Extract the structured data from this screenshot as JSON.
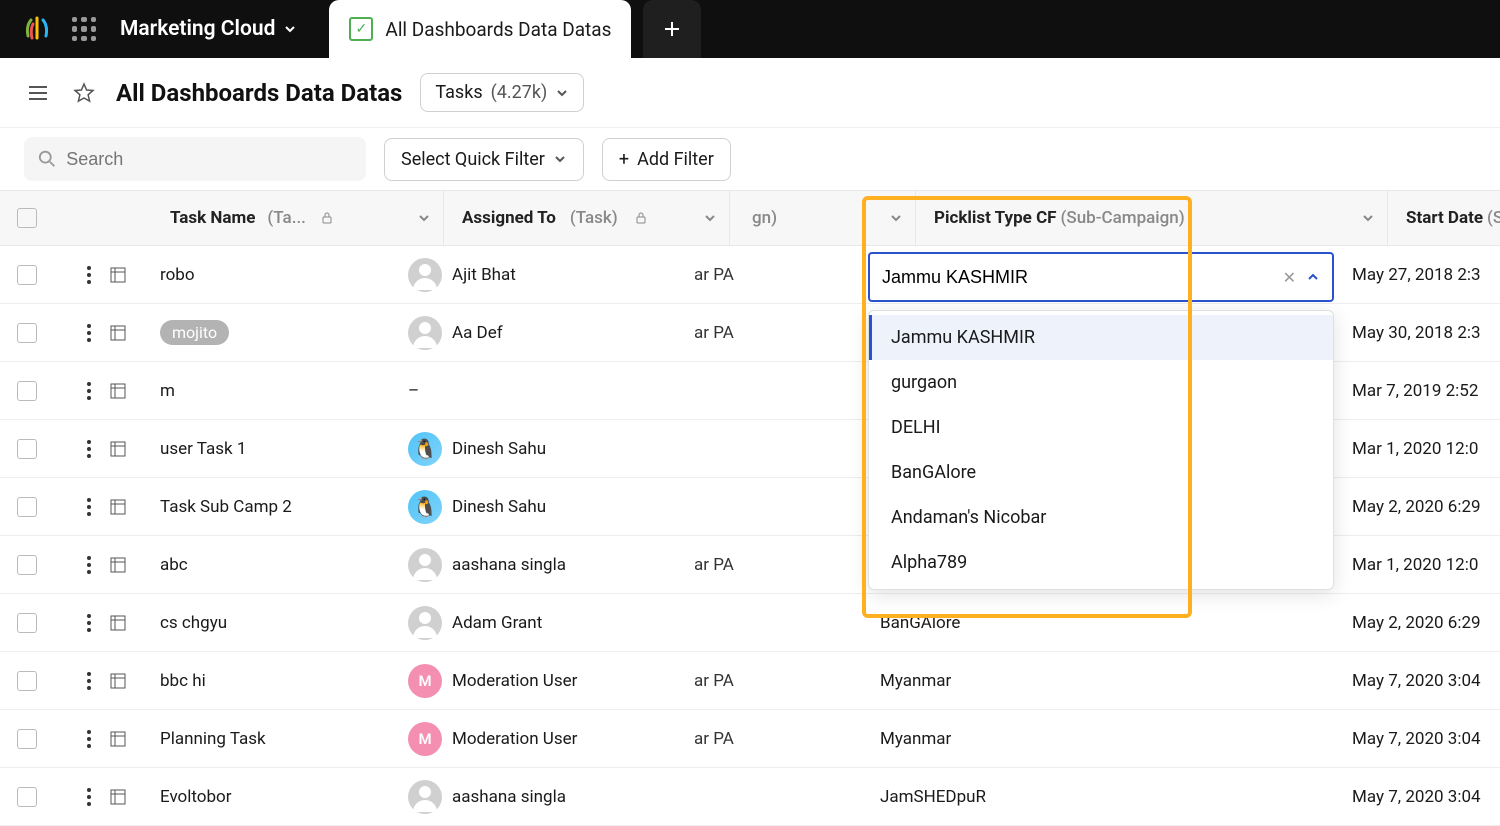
{
  "topbar": {
    "product_name": "Marketing Cloud",
    "active_tab": "All Dashboards Data Datas"
  },
  "header": {
    "title": "All Dashboards Data Datas",
    "tasks_label": "Tasks",
    "tasks_count": "(4.27k)"
  },
  "filters": {
    "search_placeholder": "Search",
    "quick_filter_label": "Select Quick Filter",
    "add_filter_label": "Add Filter"
  },
  "columns": {
    "taskname": {
      "label": "Task Name",
      "sub": "(Ta..."
    },
    "assigned": {
      "label": "Assigned To",
      "sub": "(Task)"
    },
    "midcut_suffix": "gn)",
    "picklist": {
      "label": "Picklist Type CF",
      "sub": "(Sub-Campaign)"
    },
    "start": {
      "label": "Start Date",
      "sub": "(Sub-"
    }
  },
  "picklist_editor": {
    "value": "Jammu KASHMIR",
    "options": [
      "Jammu KASHMIR",
      "gurgaon",
      "DELHI",
      "BanGAlore",
      "Andaman's Nicobar",
      "Alpha789"
    ]
  },
  "rows": [
    {
      "task": "robo",
      "chip": false,
      "assignee": "Ajit Bhat",
      "avatar": "gray",
      "initial": "",
      "midcut": "ar PA",
      "picklist": "",
      "start": "May 27, 2018 2:3"
    },
    {
      "task": "mojito",
      "chip": true,
      "assignee": "Aa Def",
      "avatar": "gray",
      "initial": "",
      "midcut": "ar PA",
      "picklist": "",
      "start": "May 30, 2018 2:3"
    },
    {
      "task": "m",
      "chip": false,
      "assignee": "–",
      "avatar": "none",
      "initial": "",
      "midcut": "",
      "picklist": "",
      "start": "Mar 7, 2019 2:52"
    },
    {
      "task": "user Task 1",
      "chip": false,
      "assignee": "Dinesh Sahu",
      "avatar": "img",
      "initial": "",
      "midcut": "",
      "picklist": "",
      "start": "Mar 1, 2020 12:0"
    },
    {
      "task": "Task Sub Camp 2",
      "chip": false,
      "assignee": "Dinesh Sahu",
      "avatar": "img",
      "initial": "",
      "midcut": "",
      "picklist": "",
      "start": "May 2, 2020 6:29"
    },
    {
      "task": "abc",
      "chip": false,
      "assignee": "aashana singla",
      "avatar": "gray",
      "initial": "",
      "midcut": "ar PA",
      "picklist": "",
      "start": "Mar 1, 2020 12:0"
    },
    {
      "task": "cs chgyu",
      "chip": false,
      "assignee": "Adam Grant",
      "avatar": "gray",
      "initial": "",
      "midcut": "",
      "picklist": "BanGAlore",
      "start": "May 2, 2020 6:29"
    },
    {
      "task": "bbc hi",
      "chip": false,
      "assignee": "Moderation User",
      "avatar": "pink",
      "initial": "M",
      "midcut": "ar PA",
      "picklist": "Myanmar",
      "start": "May 7, 2020 3:04"
    },
    {
      "task": "Planning Task",
      "chip": false,
      "assignee": "Moderation User",
      "avatar": "pink",
      "initial": "M",
      "midcut": "ar PA",
      "picklist": "Myanmar",
      "start": "May 7, 2020 3:04"
    },
    {
      "task": "Evoltobor",
      "chip": false,
      "assignee": "aashana singla",
      "avatar": "gray",
      "initial": "",
      "midcut": "",
      "picklist": "JamSHEDpuR",
      "start": "May 7, 2020 3:04"
    }
  ]
}
